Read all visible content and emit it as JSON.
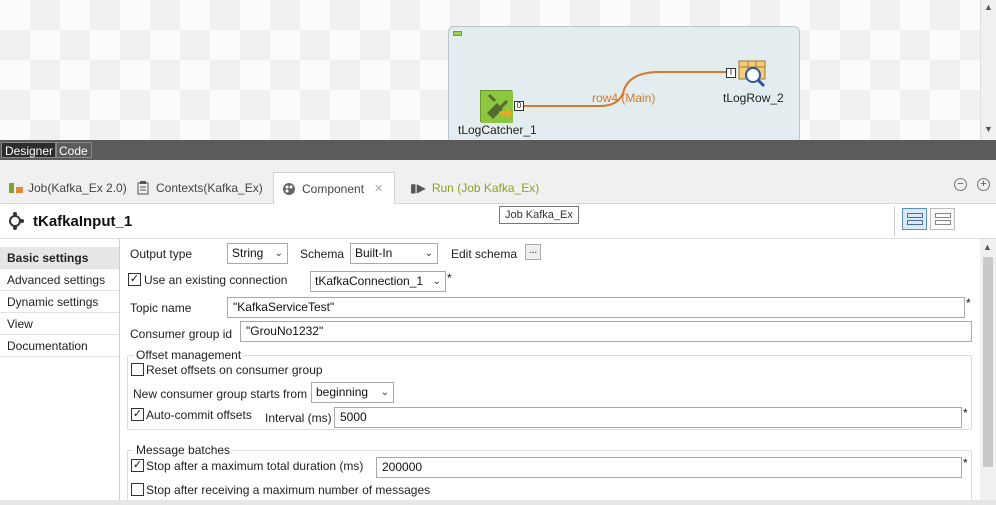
{
  "canvas": {
    "components": {
      "log_catcher": "tLogCatcher_1",
      "log_row": "tLogRow_2"
    },
    "link_label": "row4 (Main)",
    "ports": {
      "out": "0",
      "in": "I"
    }
  },
  "designer_tabs": {
    "designer": "Designer",
    "code": "Code"
  },
  "view_tabs": {
    "job": "Job(Kafka_Ex 2.0)",
    "contexts": "Contexts(Kafka_Ex)",
    "component": "Component",
    "run": "Run (Job Kafka_Ex)"
  },
  "tooltip": "Job Kafka_Ex",
  "component_title": "tKafkaInput_1",
  "sidebar": {
    "items": [
      {
        "label": "Basic settings"
      },
      {
        "label": "Advanced settings"
      },
      {
        "label": "Dynamic settings"
      },
      {
        "label": "View"
      },
      {
        "label": "Documentation"
      }
    ]
  },
  "form": {
    "output_type_label": "Output type",
    "output_type_value": "String",
    "schema_label": "Schema",
    "schema_value": "Built-In",
    "edit_schema_label": "Edit schema",
    "edit_schema_button": "...",
    "use_existing_label": "Use an existing connection",
    "use_existing_checked": true,
    "connection_value": "tKafkaConnection_1",
    "topic_label": "Topic name",
    "topic_value": "\"KafkaServiceTest\"",
    "group_id_label": "Consumer group id",
    "group_id_value": "\"GrouNo1232\"",
    "offset_group_title": "Offset management",
    "reset_offsets_label": "Reset offsets on consumer group",
    "reset_offsets_checked": false,
    "new_group_starts_label": "New consumer group starts from",
    "new_group_starts_value": "beginning",
    "auto_commit_label": "Auto-commit offsets",
    "auto_commit_checked": true,
    "interval_label": "Interval (ms)",
    "interval_value": "5000",
    "batches_group_title": "Message batches",
    "stop_duration_label": "Stop after a maximum total duration (ms)",
    "stop_duration_checked": true,
    "stop_duration_value": "200000",
    "stop_messages_label": "Stop after receiving a maximum number of messages",
    "stop_messages_checked": false,
    "required_mark": "*",
    "check_mark": "✓"
  }
}
